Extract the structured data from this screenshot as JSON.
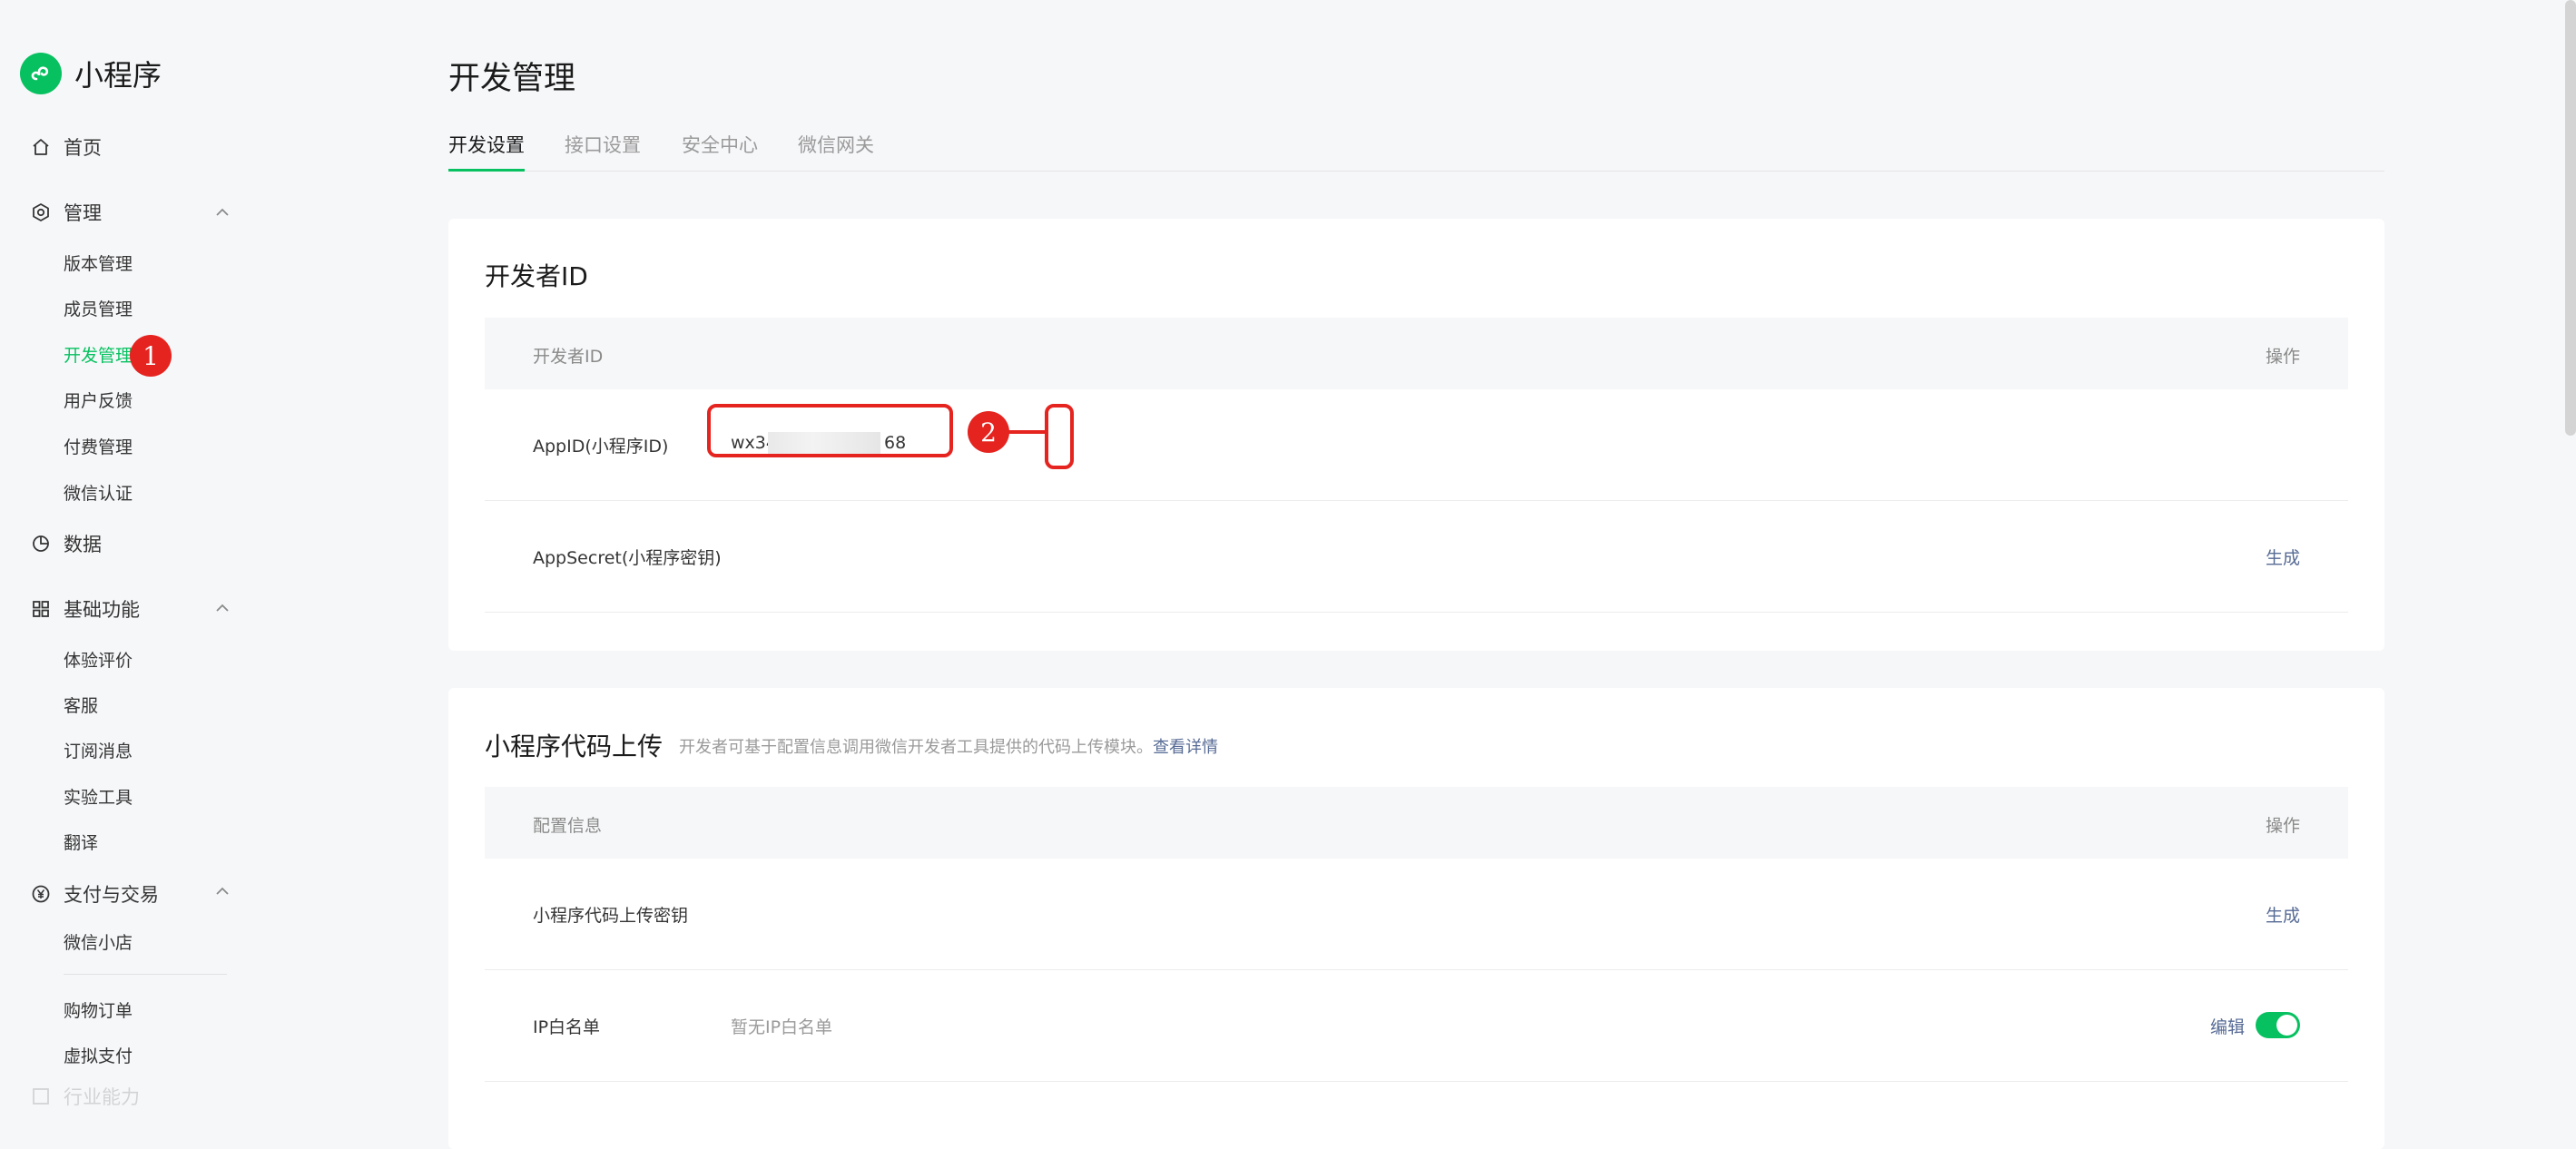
{
  "app": {
    "name": "小程序"
  },
  "sidebar": {
    "home": "首页",
    "manage": {
      "label": "管理",
      "items": [
        "版本管理",
        "成员管理",
        "开发管理",
        "用户反馈",
        "付费管理",
        "微信认证"
      ]
    },
    "data": "数据",
    "basic": {
      "label": "基础功能",
      "items": [
        "体验评价",
        "客服",
        "订阅消息",
        "实验工具",
        "翻译"
      ]
    },
    "pay": {
      "label": "支付与交易",
      "items": [
        "微信小店",
        "购物订单",
        "虚拟支付"
      ]
    },
    "cut_off": "行业能力"
  },
  "annotations": {
    "step1": "1",
    "step2": "2"
  },
  "page": {
    "title": "开发管理",
    "tabs": [
      "开发设置",
      "接口设置",
      "安全中心",
      "微信网关"
    ]
  },
  "dev_id": {
    "title": "开发者ID",
    "header": {
      "col1": "开发者ID",
      "col_action": "操作"
    },
    "appid": {
      "label": "AppID(小程序ID)",
      "value_prefix": "wx34",
      "value_suffix": "68"
    },
    "appsecret": {
      "label": "AppSecret(小程序密钥)",
      "action": "生成"
    }
  },
  "upload": {
    "title": "小程序代码上传",
    "desc": "开发者可基于配置信息调用微信开发者工具提供的代码上传模块。",
    "desc_link": "查看详情",
    "header": {
      "col1": "配置信息",
      "col_action": "操作"
    },
    "key_row": {
      "label": "小程序代码上传密钥",
      "action": "生成"
    },
    "ip_row": {
      "label": "IP白名单",
      "value": "暂无IP白名单",
      "action": "编辑",
      "toggle_on": true
    }
  },
  "colors": {
    "accent": "#07c160",
    "link": "#576b95",
    "annotation_red": "#e52420"
  }
}
